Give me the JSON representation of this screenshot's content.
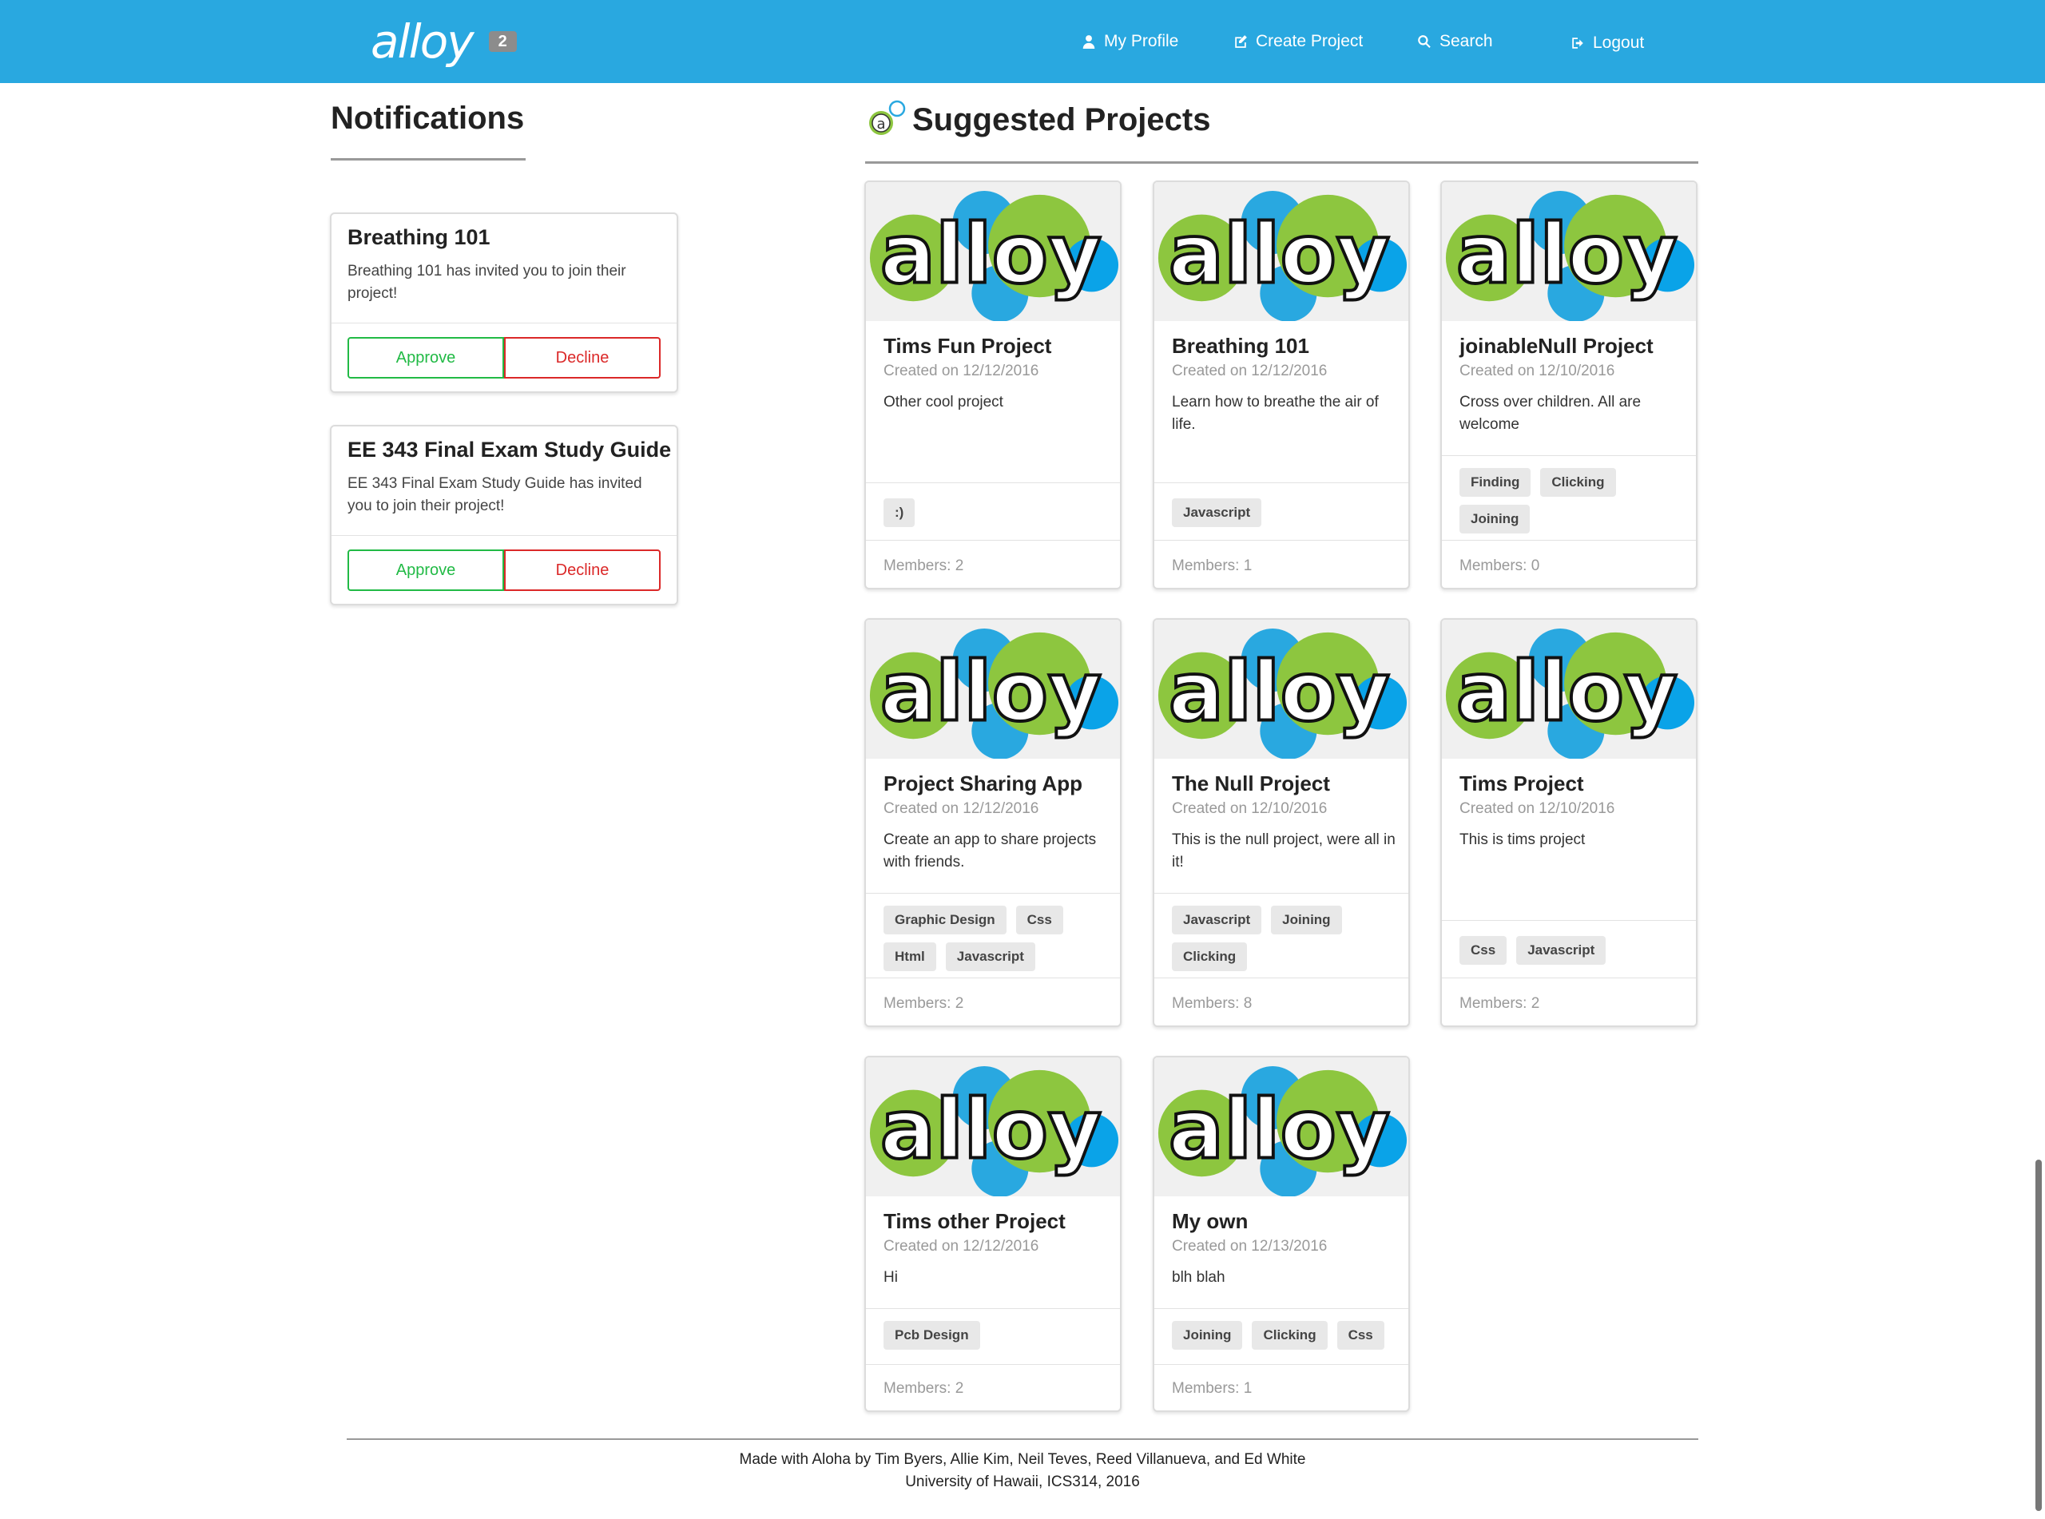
{
  "nav": {
    "brand": "alloy",
    "badge": "2",
    "items": [
      {
        "label": "My Profile",
        "icon": "user-icon"
      },
      {
        "label": "Create Project",
        "icon": "edit-icon"
      },
      {
        "label": "Search",
        "icon": "search-icon"
      },
      {
        "label": "Logout",
        "icon": "logout-icon"
      }
    ]
  },
  "colors": {
    "navbar": "#29a8e0",
    "approve": "#21ba45",
    "decline": "#db2828",
    "logo_green": "#8dc63f",
    "logo_blue": "#29a8e0"
  },
  "notifications": {
    "title": "Notifications",
    "items": [
      {
        "title": "Breathing 101",
        "message": "Breathing 101 has invited you to join their project!",
        "approve": "Approve",
        "decline": "Decline"
      },
      {
        "title": "EE 343 Final Exam Study Guide",
        "message": "EE 343 Final Exam Study Guide has invited you to join their project!",
        "approve": "Approve",
        "decline": "Decline"
      }
    ]
  },
  "suggested": {
    "title": "Suggested Projects",
    "image_text": "alloy",
    "projects": [
      {
        "title": "Tims Fun Project",
        "created": "Created on 12/12/2016",
        "description": "Other cool project",
        "tags": [
          ":)"
        ],
        "members": "Members: 2"
      },
      {
        "title": "Breathing 101",
        "created": "Created on 12/12/2016",
        "description": "Learn how to breathe the air of life.",
        "tags": [
          "Javascript"
        ],
        "members": "Members: 1"
      },
      {
        "title": "joinableNull Project",
        "created": "Created on 12/10/2016",
        "description": "Cross over children. All are welcome",
        "tags": [
          "Finding",
          "Clicking",
          "Joining"
        ],
        "members": "Members: 0"
      },
      {
        "title": "Project Sharing App",
        "created": "Created on 12/12/2016",
        "description": "Create an app to share projects with friends.",
        "tags": [
          "Graphic Design",
          "Css",
          "Html",
          "Javascript"
        ],
        "members": "Members: 2"
      },
      {
        "title": "The Null Project",
        "created": "Created on 12/10/2016",
        "description": "This is the null project, were all in it!",
        "tags": [
          "Javascript",
          "Joining",
          "Clicking"
        ],
        "members": "Members: 8"
      },
      {
        "title": "Tims Project",
        "created": "Created on 12/10/2016",
        "description": "This is tims project",
        "tags": [
          "Css",
          "Javascript"
        ],
        "members": "Members: 2"
      },
      {
        "title": "Tims other Project",
        "created": "Created on 12/12/2016",
        "description": "Hi",
        "tags": [
          "Pcb Design"
        ],
        "members": "Members: 2"
      },
      {
        "title": "My own",
        "created": "Created on 12/13/2016",
        "description": "blh blah",
        "tags": [
          "Joining",
          "Clicking",
          "Css"
        ],
        "members": "Members: 1"
      }
    ]
  },
  "footer": {
    "line1": "Made with Aloha by Tim Byers, Allie Kim, Neil Teves, Reed Villanueva, and Ed White",
    "line2": "University of Hawaii, ICS314, 2016"
  }
}
